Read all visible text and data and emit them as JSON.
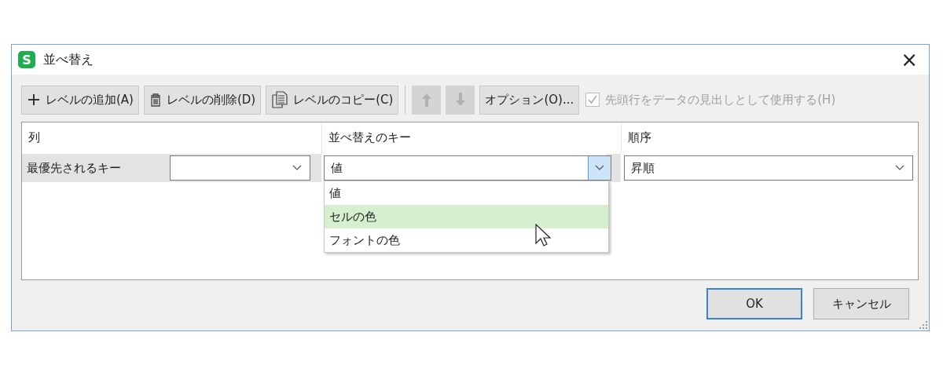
{
  "window": {
    "app_icon": "S",
    "title": "並べ替え",
    "close": "×"
  },
  "toolbar": {
    "buttons": [
      {
        "kind": "add",
        "label": "レベルの追加(A)"
      },
      {
        "kind": "delete",
        "label": "レベルの削除(D)"
      },
      {
        "kind": "copy",
        "label": "レベルのコピー(C)"
      }
    ],
    "move_buttons": [
      {
        "kind": "up",
        "disabled": true
      },
      {
        "kind": "down",
        "disabled": true
      }
    ],
    "options_button": "オプション(O)...",
    "header_checkbox": {
      "label": "先頭行をデータの見出しとして使用する(H)",
      "checked": true,
      "disabled": true
    }
  },
  "grid": {
    "columns": [
      "列",
      "並べ替えのキー",
      "順序"
    ],
    "rows": [
      {
        "label": "最優先されるキー",
        "key": {
          "value": "値",
          "expanded": true,
          "options": [
            {
              "label": "値",
              "highlighted": false
            },
            {
              "label": "セルの色",
              "highlighted": true
            },
            {
              "label": "フォントの色",
              "highlighted": false
            }
          ]
        },
        "order": "昇順"
      }
    ]
  },
  "buttons": [
    {
      "label": "OK",
      "default": true
    },
    {
      "label": "キャンセル",
      "default": false
    }
  ]
}
